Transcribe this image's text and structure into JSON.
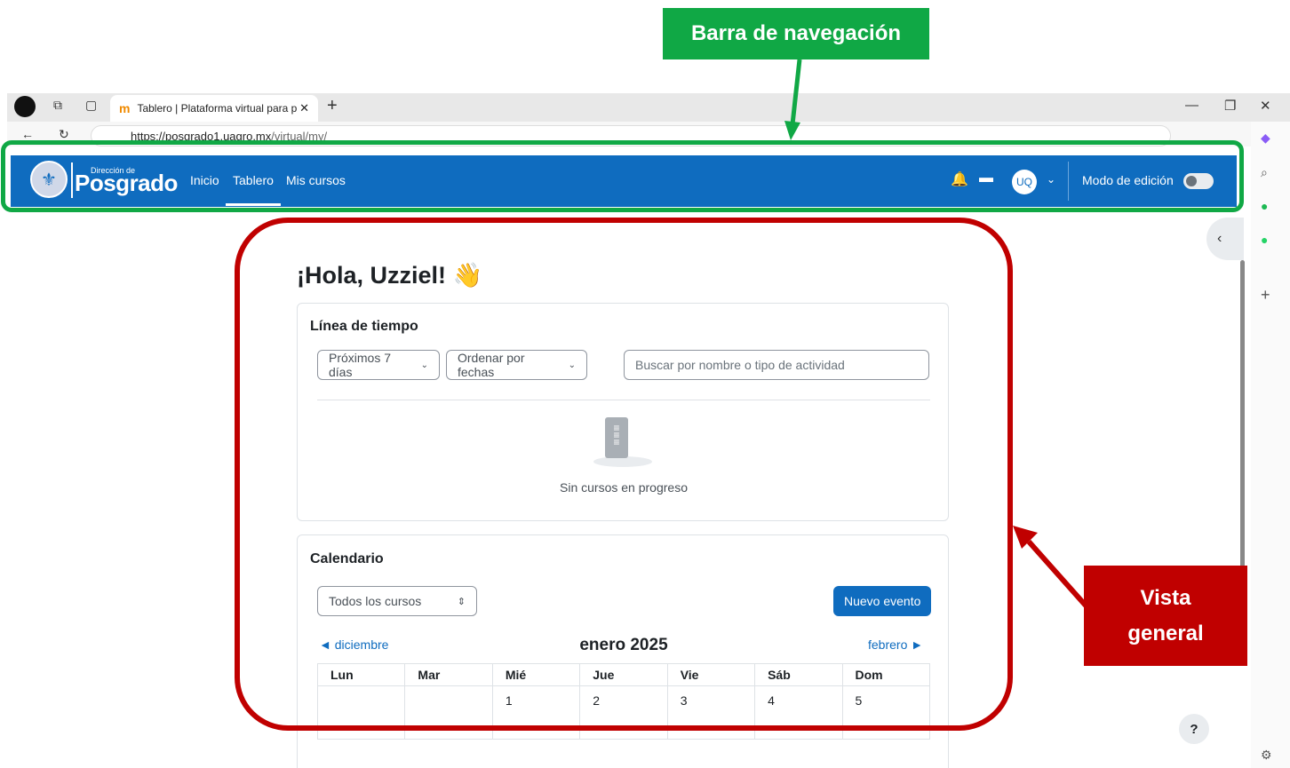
{
  "annotations": {
    "nav_label": "Barra de navegación",
    "view_line1": "Vista",
    "view_line2": "general"
  },
  "browser": {
    "tab_title": "Tablero | Plataforma virtual para p",
    "url_host": "https://posgrado1.uagro.mx",
    "url_path": "/virtual/my/"
  },
  "navbar": {
    "logo_small": "Dirección de",
    "logo_big": "Posgrado",
    "links": [
      "Inicio",
      "Tablero",
      "Mis cursos"
    ],
    "avatar": "UQ",
    "edit_mode": "Modo de edición"
  },
  "greeting": "¡Hola, Uzziel! 👋",
  "timeline": {
    "title": "Línea de tiempo",
    "filter": "Próximos 7 días",
    "sort": "Ordenar por fechas",
    "search_placeholder": "Buscar por nombre o tipo de actividad",
    "empty": "Sin cursos en progreso"
  },
  "calendar": {
    "title": "Calendario",
    "course_select": "Todos los cursos",
    "new_event": "Nuevo evento",
    "prev": "diciembre",
    "month": "enero 2025",
    "next": "febrero",
    "weekdays": [
      "Lun",
      "Mar",
      "Mié",
      "Jue",
      "Vie",
      "Sáb",
      "Dom"
    ],
    "week1": [
      "",
      "",
      "1",
      "2",
      "3",
      "4",
      "5"
    ]
  },
  "help": "?"
}
